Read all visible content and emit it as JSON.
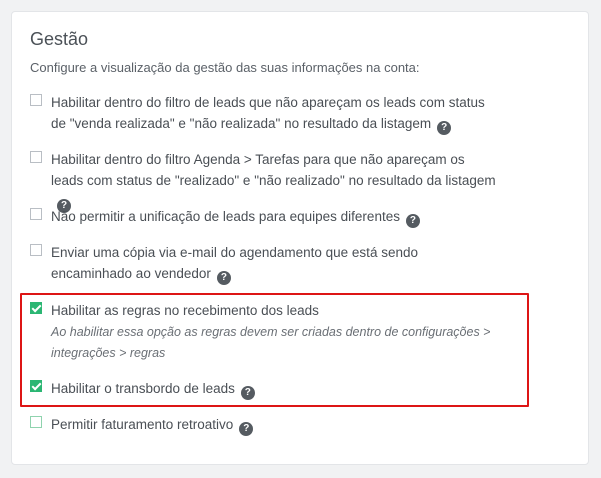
{
  "section": {
    "title": "Gestão",
    "subtitle": "Configure a visualização da gestão das suas informações na conta:"
  },
  "options": [
    {
      "label": "Habilitar dentro do filtro de leads que não apareçam os leads com status de \"venda realizada\" e \"não realizada\" no resultado da listagem",
      "checked": false,
      "help_icon": "question-circle-icon"
    },
    {
      "label": "Habilitar dentro do filtro Agenda > Tarefas para que não apareçam os leads com status de \"realizado\" e \"não realizado\" no resultado da listagem",
      "checked": false,
      "help_icon": "question-circle-icon"
    },
    {
      "label": "Não permitir a unificação de leads para equipes diferentes",
      "checked": false,
      "help_icon": "question-circle-icon"
    },
    {
      "label": "Enviar uma cópia via e-mail do agendamento que está sendo encaminhado ao vendedor",
      "checked": false,
      "help_icon": "question-circle-icon"
    },
    {
      "label": "Habilitar as regras no recebimento dos leads",
      "checked": true,
      "note": "Ao habilitar essa opção as regras devem ser criadas dentro de configurações > integrações > regras"
    },
    {
      "label": "Habilitar o transbordo de leads",
      "checked": true,
      "help_icon": "question-circle-icon"
    },
    {
      "label": "Permitir faturamento retroativo",
      "checked": false,
      "help_icon": "question-circle-icon"
    }
  ],
  "help_glyph": "?",
  "colors": {
    "checked": "#2bb673",
    "highlight_border": "#dd1515"
  }
}
